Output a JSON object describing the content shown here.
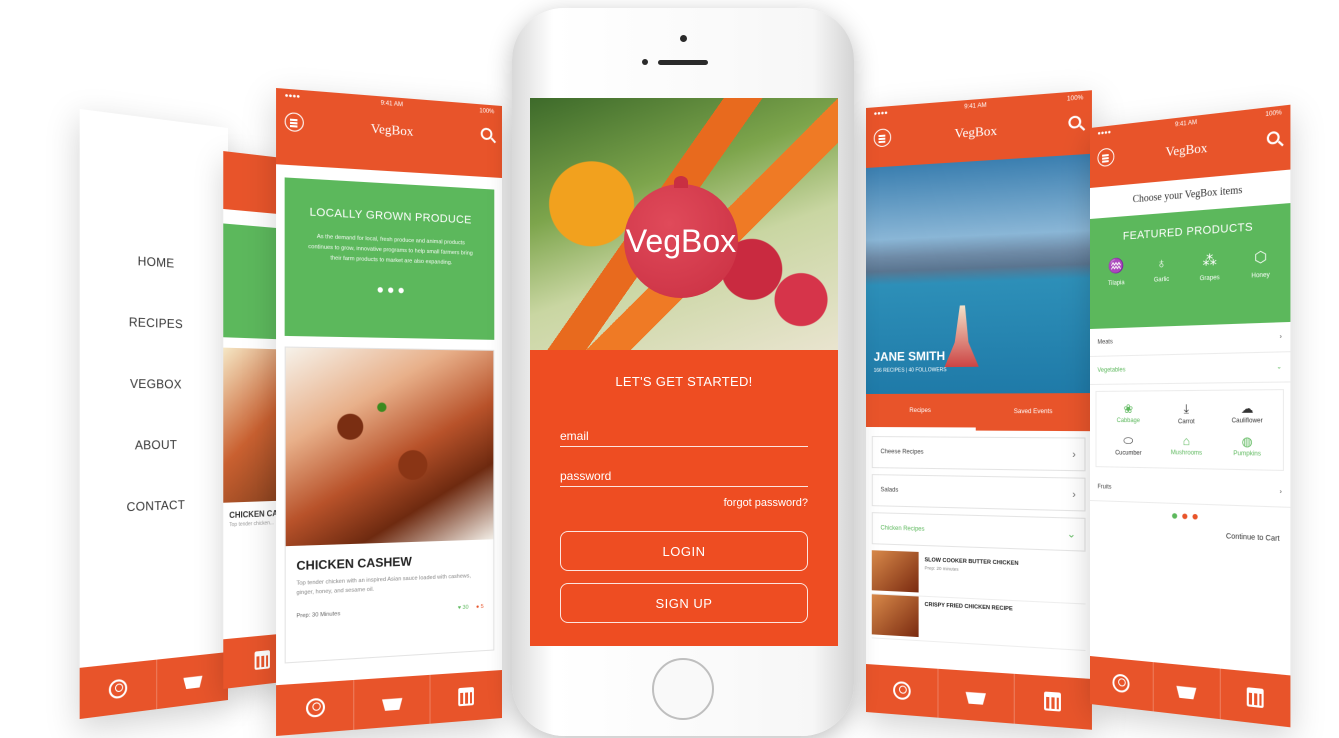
{
  "menu_screen": {
    "items": [
      "HOME",
      "RECIPES",
      "VEGBOX",
      "ABOUT",
      "CONTACT"
    ]
  },
  "peek_screen": {
    "card_title": "CHICKEN CA",
    "card_sub": "Top tender chicken..."
  },
  "card_screen": {
    "status_time": "9:41 AM",
    "status_battery": "100%",
    "app_title": "VegBox",
    "promo_title": "LOCALLY GROWN PRODUCE",
    "promo_text": "As the demand for local, fresh produce and animal products continues to grow, innovative programs to help small farmers bring their farm products to market are also expanding.",
    "promo_dots": "●●●",
    "food_title": "CHICKEN CASHEW",
    "food_desc": "Top tender chicken with an inspired Asian sauce loaded with cashews, ginger, honey, and sesame oil.",
    "food_prep": "Prep: 30 Minutes",
    "likes": "30",
    "dislikes": "5"
  },
  "center_phone": {
    "logo_text": "VegBox",
    "heading": "LET'S GET STARTED!",
    "email_placeholder": "email",
    "password_placeholder": "password",
    "forgot_label": "forgot password?",
    "login_label": "LOGIN",
    "signup_label": "SIGN UP"
  },
  "profile_screen": {
    "status_time": "9:41 AM",
    "status_battery": "100%",
    "app_title": "VegBox",
    "name": "JANE SMITH",
    "stats": "166 RECIPES | 40 FOLLOWERS",
    "tabs": [
      "Recipes",
      "Saved Events"
    ],
    "rows": [
      "Cheese Recipes",
      "Salads",
      "Chicken Recipes"
    ],
    "recipe1_title": "SLOW COOKER BUTTER CHICKEN",
    "recipe1_sub": "Prep: 20 minutes",
    "recipe2_title": "CRISPY FRIED CHICKEN RECIPE"
  },
  "shop_screen": {
    "status_time": "9:41 AM",
    "status_battery": "100%",
    "app_title": "VegBox",
    "choose": "Choose your VegBox items",
    "featured_title": "FEATURED PRODUCTS",
    "featured_items": [
      "Tilapia",
      "Garlic",
      "Grapes",
      "Honey"
    ],
    "categories": [
      "Meats",
      "Vegetables",
      "Fruits"
    ],
    "vegetables": [
      "Cabbage",
      "Carrot",
      "Cauliflower",
      "Cucumber",
      "Mushrooms",
      "Pumpkins"
    ],
    "continue_label": "Continue to Cart"
  },
  "colors": {
    "accent_orange": "#e8542a",
    "accent_green": "#5cb85c"
  }
}
